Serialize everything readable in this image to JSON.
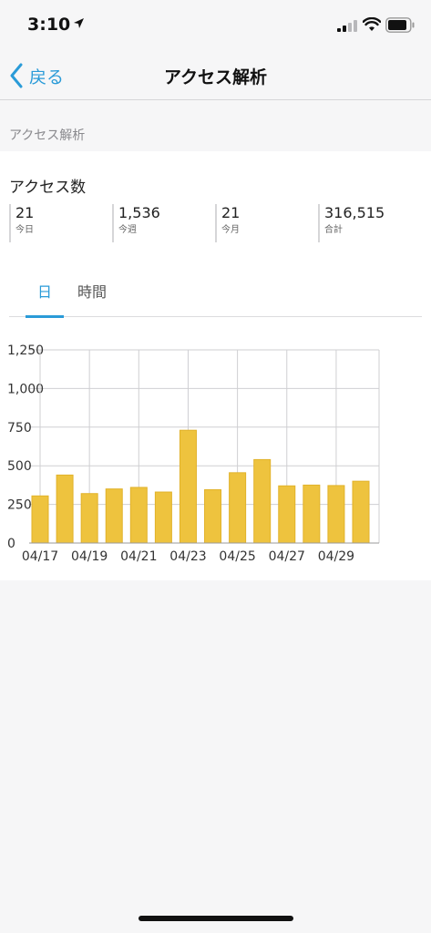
{
  "status_bar": {
    "time": "3:10"
  },
  "nav": {
    "back_label": "戻る",
    "title": "アクセス解析"
  },
  "section_header": "アクセス解析",
  "card": {
    "title": "アクセス数",
    "stats": [
      {
        "value": "21",
        "label": "今日"
      },
      {
        "value": "1,536",
        "label": "今週"
      },
      {
        "value": "21",
        "label": "今月"
      },
      {
        "value": "316,515",
        "label": "合計"
      }
    ],
    "tabs": [
      {
        "label": "日",
        "active": true
      },
      {
        "label": "時間",
        "active": false
      }
    ]
  },
  "colors": {
    "accent": "#2a9bd8",
    "bar": "#eec33e",
    "bar_stroke": "#e1b22a",
    "grid": "#cfcfd2"
  },
  "chart_data": {
    "type": "bar",
    "categories": [
      "04/17",
      "04/18",
      "04/19",
      "04/20",
      "04/21",
      "04/22",
      "04/23",
      "04/24",
      "04/25",
      "04/26",
      "04/27",
      "04/28",
      "04/29",
      "04/30"
    ],
    "x_tick_labels": [
      "04/17",
      "04/19",
      "04/21",
      "04/23",
      "04/25",
      "04/27",
      "04/29"
    ],
    "values": [
      305,
      440,
      320,
      350,
      360,
      330,
      730,
      345,
      455,
      540,
      370,
      375,
      372,
      400
    ],
    "y_ticks": [
      "0",
      "250",
      "500",
      "750",
      "1,000",
      "1,250"
    ],
    "ylim": [
      0,
      1250
    ],
    "grid": true
  }
}
